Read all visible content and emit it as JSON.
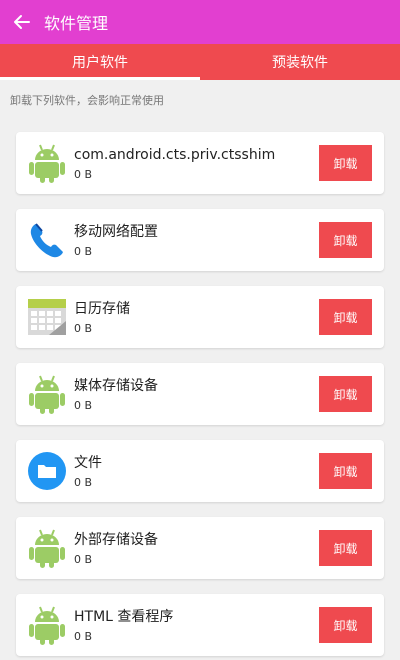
{
  "header": {
    "title": "软件管理",
    "bg_color": "#e23fd0"
  },
  "tabs": [
    {
      "label": "用户软件",
      "active": true
    },
    {
      "label": "预装软件",
      "active": false
    }
  ],
  "hint": "卸载下列软件，会影响正常使用",
  "apps": [
    {
      "name": "com.android.cts.priv.ctsshim",
      "size": "0 B",
      "icon": "android-icon",
      "action": "卸载"
    },
    {
      "name": "移动网络配置",
      "size": "0 B",
      "icon": "phone-icon",
      "action": "卸载"
    },
    {
      "name": "日历存储",
      "size": "0 B",
      "icon": "calendar-icon",
      "action": "卸载"
    },
    {
      "name": "媒体存储设备",
      "size": "0 B",
      "icon": "android-icon",
      "action": "卸载"
    },
    {
      "name": "文件",
      "size": "0 B",
      "icon": "folder-icon",
      "action": "卸载"
    },
    {
      "name": "外部存储设备",
      "size": "0 B",
      "icon": "android-icon",
      "action": "卸载"
    },
    {
      "name": "HTML 查看程序",
      "size": "0 B",
      "icon": "android-icon",
      "action": "卸载"
    }
  ]
}
